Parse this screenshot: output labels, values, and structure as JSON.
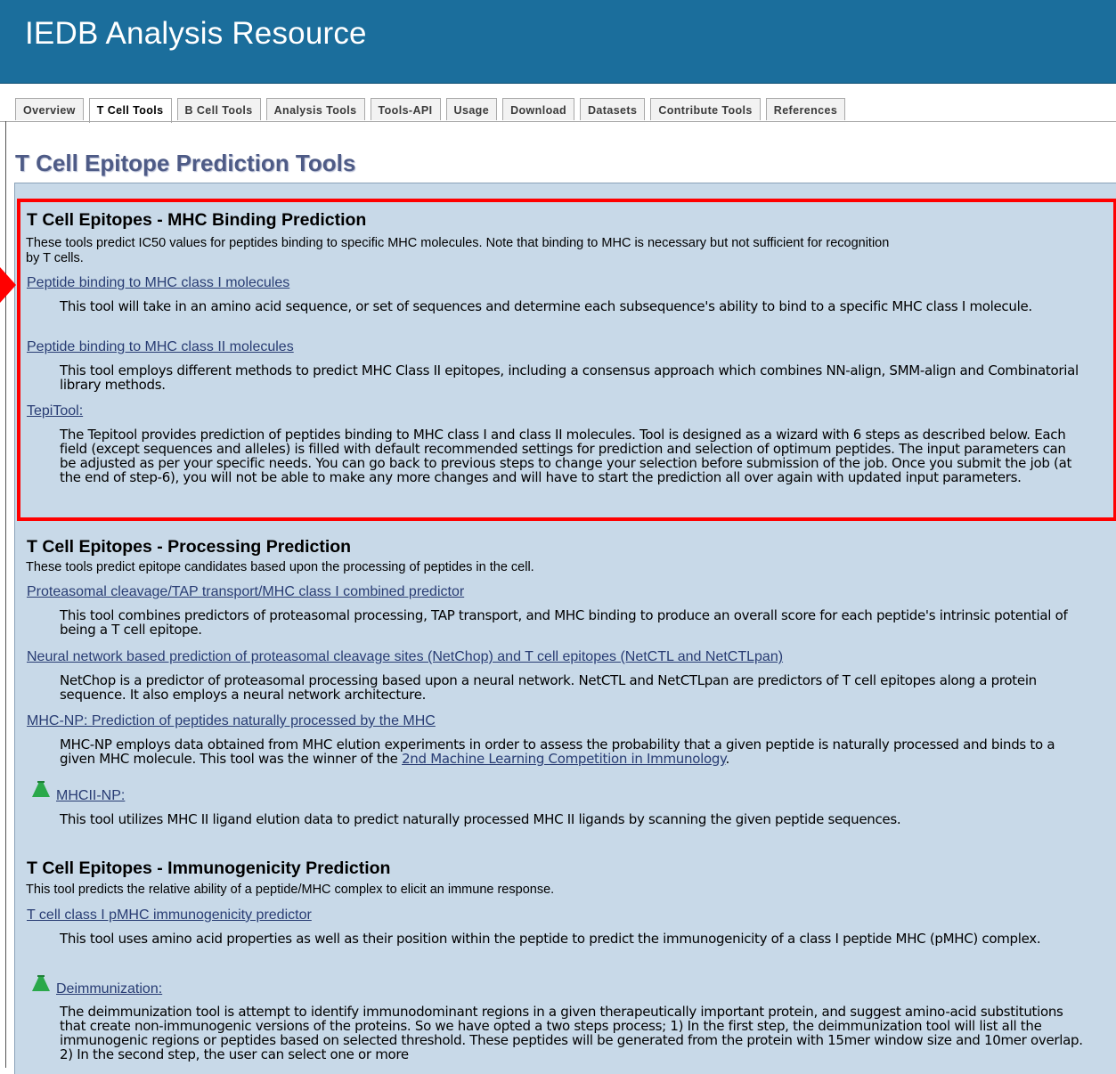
{
  "header": {
    "title": "IEDB Analysis Resource"
  },
  "tabs": [
    "Overview",
    "T Cell Tools",
    "B Cell Tools",
    "Analysis Tools",
    "Tools-API",
    "Usage",
    "Download",
    "Datasets",
    "Contribute Tools",
    "References"
  ],
  "active_tab": "T Cell Tools",
  "page_title": "T Cell Epitope Prediction Tools",
  "colors": {
    "header_bg": "#1b6e9c",
    "panel_bg": "#c8d9e8",
    "highlight": "#ff0000",
    "title": "#4e5b86",
    "link": "#283c73",
    "flask": "#2aa84a"
  },
  "sections": [
    {
      "title": "T Cell Epitopes - MHC Binding Prediction",
      "desc_line1": "These tools predict IC50 values for peptides binding to specific MHC molecules.  Note that binding to MHC is necessary but not sufficient for recognition",
      "desc_line2": "by T cells.",
      "tools": [
        {
          "name": "Peptide binding to MHC class I molecules",
          "desc": "This tool will take in an amino acid sequence, or set of sequences and determine each subsequence's ability to bind to a specific MHC class I molecule."
        },
        {
          "name": "Peptide binding to MHC class II molecules",
          "desc": "This tool employs different methods to predict MHC Class II epitopes, including a consensus approach which combines NN-align, SMM-align and Combinatorial library methods."
        },
        {
          "name": "TepiTool",
          "desc": "The Tepitool provides prediction of peptides binding to MHC class I and class II molecules. Tool is designed as a wizard with 6 steps as described below. Each field (except sequences and alleles) is filled with default recommended settings for prediction and selection of optimum peptides. The input parameters can be adjusted as per your specific needs. You can go back to previous steps to change your selection before submission of the job. Once you submit the job (at the end of step-6), you will not be able to make any more changes and will have to start the prediction all over again with updated input parameters."
        }
      ]
    },
    {
      "title": "T Cell Epitopes - Processing Prediction",
      "desc": "These tools predict epitope candidates based upon the processing of peptides in the cell.",
      "tools": [
        {
          "name": "Proteasomal cleavage/TAP transport/MHC class I combined predictor",
          "desc": "This tool combines predictors of proteasomal processing, TAP transport, and MHC binding to produce an overall score for each peptide's intrinsic potential of being a T cell epitope."
        },
        {
          "name": "Neural network based prediction of proteasomal cleavage sites (NetChop) and T cell epitopes (NetCTL and NetCTLpan)",
          "desc": "NetChop is a predictor of proteasomal processing based upon a neural network. NetCTL and NetCTLpan are predictors of T cell epitopes along a protein sequence. It also employs a neural network architecture."
        },
        {
          "name": "MHC-NP: Prediction of peptides naturally processed by the MHC",
          "desc": "MHC-NP employs data obtained from MHC elution experiments in order to assess the probability that a given peptide is naturally processed and binds to a given MHC molecule. This tool was the winner of the",
          "desc_link": "2nd Machine Learning Competition in Immunology",
          "desc_end": "."
        },
        {
          "name": "MHCII-NP",
          "desc": "This tool utilizes MHC II ligand elution data to predict naturally processed MHC II ligands by scanning the given peptide sequences."
        }
      ]
    },
    {
      "title": "T Cell Epitopes - Immunogenicity Prediction",
      "desc": "This tool predicts the relative ability of a peptide/MHC complex to elicit an immune response.",
      "tools": [
        {
          "name": "T cell class I pMHC immunogenicity predictor",
          "desc": "This tool uses amino acid properties as well as their position within the peptide to predict the immunogenicity of a class I peptide MHC (pMHC) complex."
        },
        {
          "name": "Deimmunization",
          "desc": "The deimmunization tool is attempt to identify immunodominant regions in a given therapeutically important protein, and suggest amino-acid substitutions that create non-immunogenic versions of the proteins. So we have opted a two steps process; 1) In the first step, the deimmunization tool will list all the immunogenic regions or peptides based on selected threshold. These peptides will be generated from the protein with 15mer window size and 10mer overlap. 2) In the second step, the user can select one or more"
        }
      ]
    }
  ],
  "colon": ":"
}
